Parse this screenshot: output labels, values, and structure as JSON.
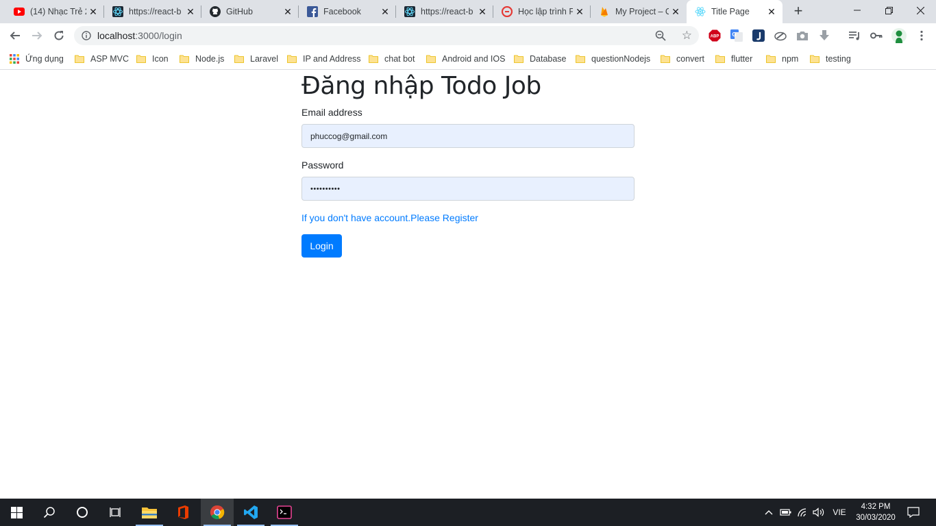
{
  "browser": {
    "tabs": [
      {
        "title": "(14) Nhạc Trẻ 2",
        "icon": "youtube-icon"
      },
      {
        "title": "https://react-b",
        "icon": "react-bootstrap-icon"
      },
      {
        "title": "GitHub",
        "icon": "github-icon"
      },
      {
        "title": "Facebook",
        "icon": "facebook-icon"
      },
      {
        "title": "https://react-b",
        "icon": "react-bootstrap-icon"
      },
      {
        "title": "Học lập trình F",
        "icon": "edu-site-icon"
      },
      {
        "title": "My Project – C",
        "icon": "firebase-icon"
      },
      {
        "title": "Title Page",
        "icon": "react-icon",
        "active": true
      }
    ],
    "address": {
      "host": "localhost",
      "path": ":3000/login"
    },
    "bookmarks": {
      "apps_label": "Ứng dụng",
      "items": [
        "ASP MVC",
        "Icon",
        "Node.js",
        "Laravel",
        "IP and Address",
        "chat bot",
        "Android and IOS",
        "Database",
        "questionNodejs",
        "convert",
        "flutter",
        "npm",
        "testing"
      ]
    }
  },
  "login": {
    "title": "Đăng nhập Todo Job",
    "email_label": "Email address",
    "email_value": "phuccog@gmail.com",
    "password_label": "Password",
    "password_value": "••••••••••",
    "register_link": "If you don't have account.Please Register",
    "login_button": "Login"
  },
  "taskbar": {
    "language": "VIE",
    "time": "4:32 PM",
    "date": "30/03/2020"
  },
  "colors": {
    "primary": "#007bff",
    "autofill_bg": "#e8f0fe",
    "tabstrip_bg": "#dee1e6",
    "taskbar_bg": "#1c1f24"
  }
}
